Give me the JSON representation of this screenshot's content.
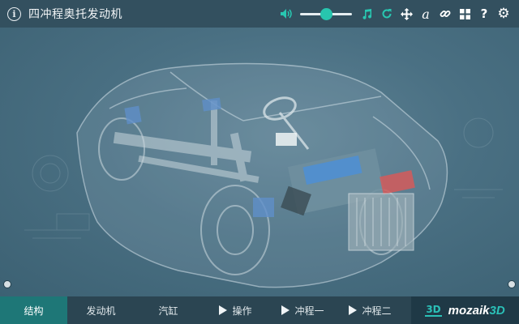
{
  "header": {
    "title": "四冲程奥托发动机",
    "info_icon": "i",
    "volume_level": 0.5
  },
  "tools": [
    {
      "name": "volume-icon",
      "glyph": "🔈"
    },
    {
      "name": "music-icon",
      "glyph": "♫"
    },
    {
      "name": "reset-icon",
      "glyph": "↻"
    },
    {
      "name": "move-icon",
      "glyph": "✥"
    },
    {
      "name": "text-icon",
      "glyph": "a"
    },
    {
      "name": "link-icon",
      "glyph": "🔗"
    },
    {
      "name": "grid-icon",
      "glyph": "▦"
    },
    {
      "name": "help-icon",
      "glyph": "?"
    },
    {
      "name": "settings-icon",
      "glyph": "⚙"
    }
  ],
  "tabs": [
    {
      "label": "结构",
      "active": true,
      "play": false
    },
    {
      "label": "发动机",
      "active": false,
      "play": false
    },
    {
      "label": "汽缸",
      "active": false,
      "play": false
    },
    {
      "label": "操作",
      "active": false,
      "play": true
    },
    {
      "label": "冲程一",
      "active": false,
      "play": true
    },
    {
      "label": "冲程二",
      "active": false,
      "play": true
    }
  ],
  "brand": {
    "badge": "3D",
    "name_main": "mozaik",
    "name_3d": "3D"
  },
  "colors": {
    "topbar": "#33505f",
    "accent": "#27c5ae",
    "active_tab": "#1e7777"
  }
}
